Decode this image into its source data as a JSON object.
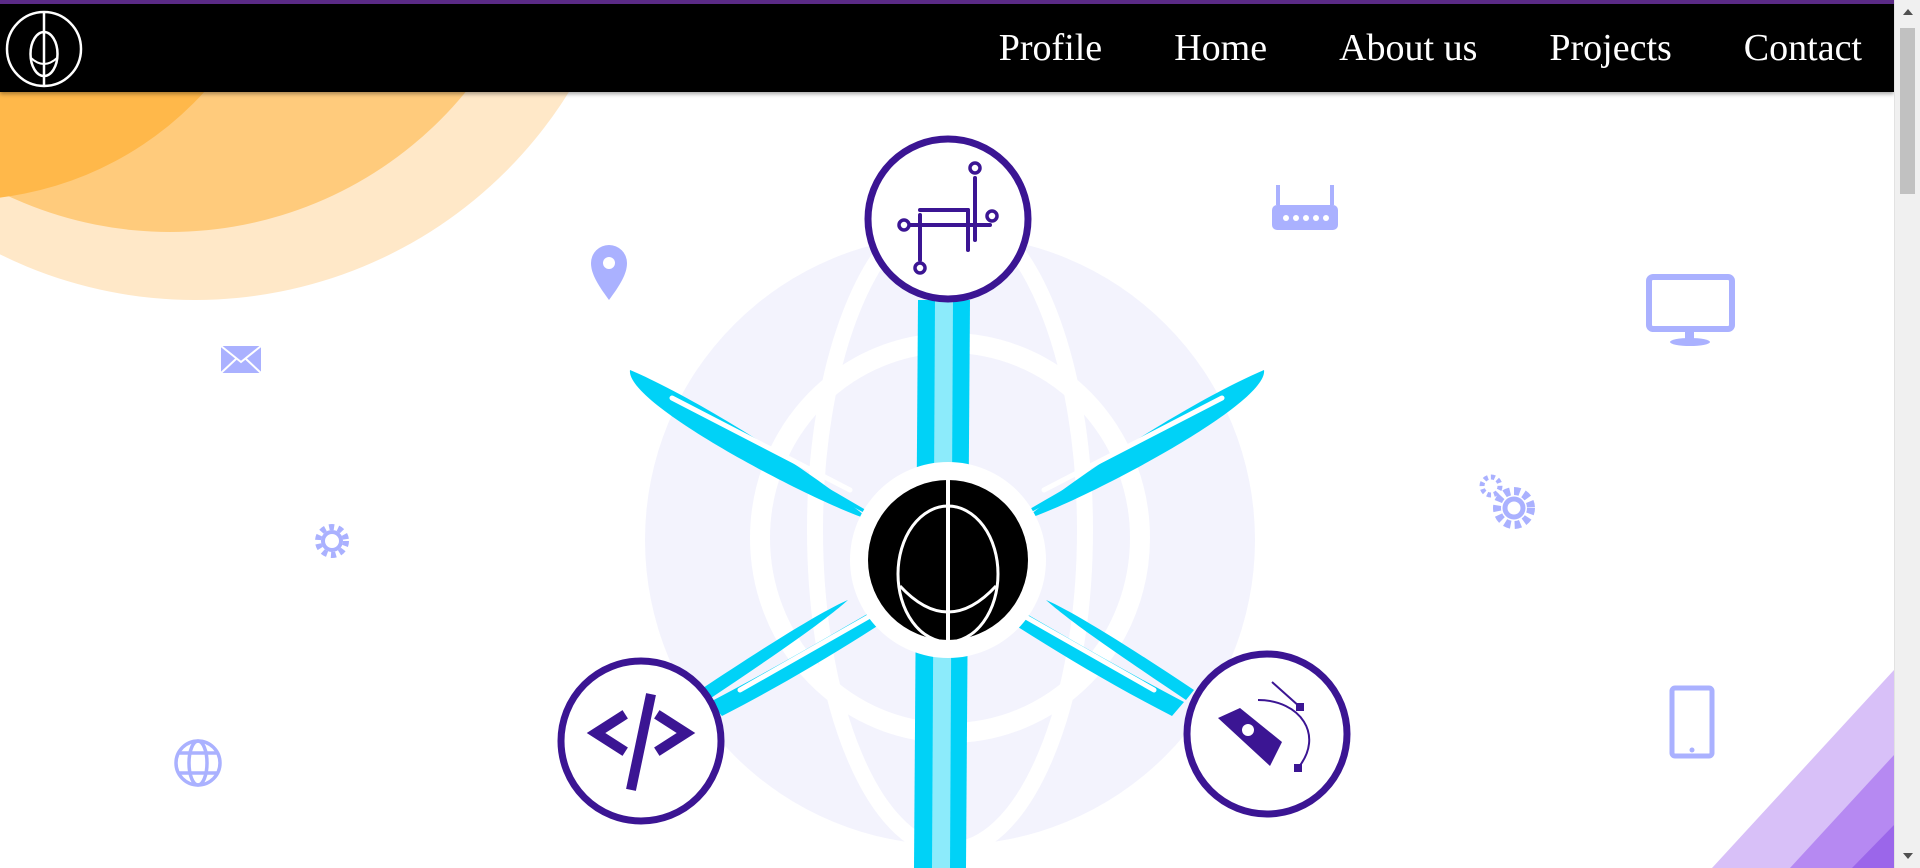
{
  "navbar": {
    "logo_icon": "site-logo",
    "links": [
      "Profile",
      "Home",
      "About us",
      "Projects",
      "Contact"
    ]
  },
  "hero": {
    "center_icon": "logo-emblem-icon",
    "service_icons": [
      "circuit-icon",
      "code-icon",
      "pen-tool-icon"
    ],
    "background_icons": [
      "location-pin-icon",
      "router-icon",
      "monitor-icon",
      "mail-icon",
      "gear-icon",
      "gears-icon",
      "globe-icon",
      "tablet-icon"
    ]
  },
  "colors": {
    "navbar_bg": "#000000",
    "top_border": "#5a2a86",
    "accent_cyan": "#00d2f7",
    "accent_purple": "#3b1593",
    "icon_lavender": "#aab1ff",
    "orange": "#ffb84a",
    "violet": "#b689f2"
  }
}
